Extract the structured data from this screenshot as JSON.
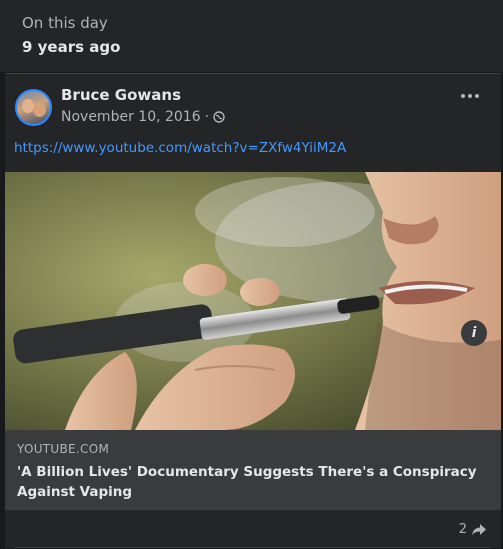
{
  "memory": {
    "label": "On this day",
    "time_ago": "9 years ago"
  },
  "post": {
    "author": "Bruce Gowans",
    "date": "November 10, 2016",
    "separator": "·",
    "privacy_icon": "globe-icon",
    "link_url": "https://www.youtube.com/watch?v=ZXfw4YiiM2A",
    "preview": {
      "domain": "YOUTUBE.COM",
      "title": "'A Billion Lives' Documentary Suggests There's a Conspiracy Against Vaping"
    },
    "info_label": "i",
    "share_count": "2"
  },
  "colors": {
    "background": "#18191a",
    "card": "#242526",
    "link": "#4599ff",
    "muted": "#b0b3b8"
  }
}
